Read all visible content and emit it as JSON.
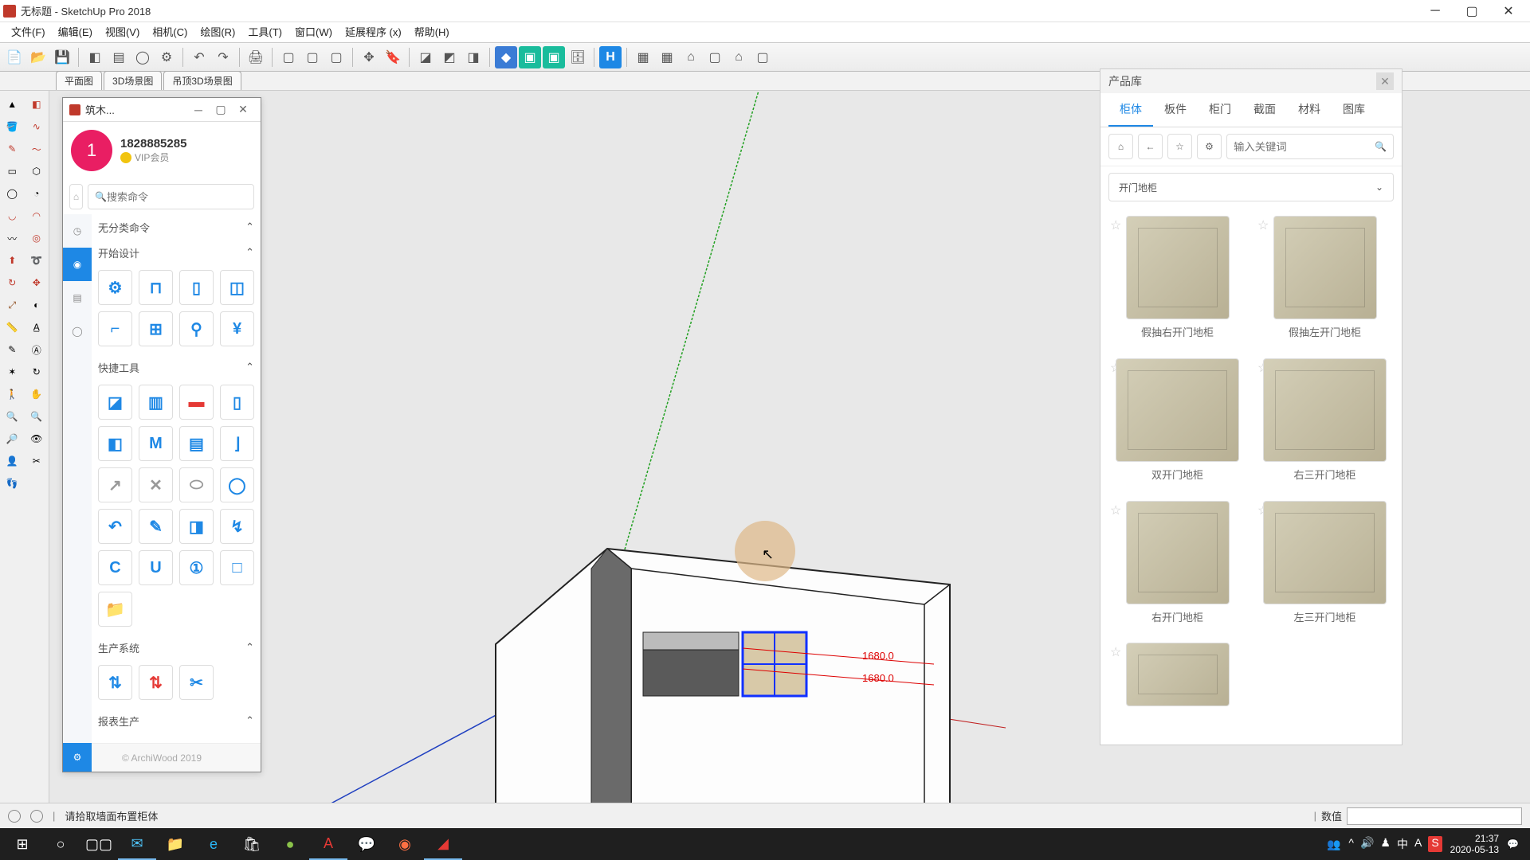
{
  "window": {
    "title": "无标题 - SketchUp Pro 2018"
  },
  "menu": [
    "文件(F)",
    "编辑(E)",
    "视图(V)",
    "相机(C)",
    "绘图(R)",
    "工具(T)",
    "窗口(W)",
    "延展程序 (x)",
    "帮助(H)"
  ],
  "scenetabs": [
    "平面图",
    "3D场景图",
    "吊顶3D场景图"
  ],
  "archiwood": {
    "title": "筑木...",
    "user_id": "1828885285",
    "vip": "VIP会员",
    "search_ph": "搜索命令",
    "sections": {
      "s1": "无分类命令",
      "s2": "开始设计",
      "s3": "快捷工具",
      "s4": "生产系统",
      "s5": "报表生产"
    },
    "footer": "© ArchiWood 2019"
  },
  "prodlib": {
    "title": "产品库",
    "tabs": [
      "柜体",
      "板件",
      "柜门",
      "截面",
      "材料",
      "图库"
    ],
    "search_ph": "输入关键词",
    "category": "开门地柜",
    "items": [
      "假抽右开门地柜",
      "假抽左开门地柜",
      "双开门地柜",
      "右三开门地柜",
      "右开门地柜",
      "左三开门地柜"
    ]
  },
  "status": {
    "hint": "请拾取墙面布置柜体",
    "valuelbl": "数值"
  },
  "dims": {
    "a": "1680.0",
    "b": "1680.0"
  },
  "taskbar": {
    "time": "21:37",
    "date": "2020-05-13"
  }
}
